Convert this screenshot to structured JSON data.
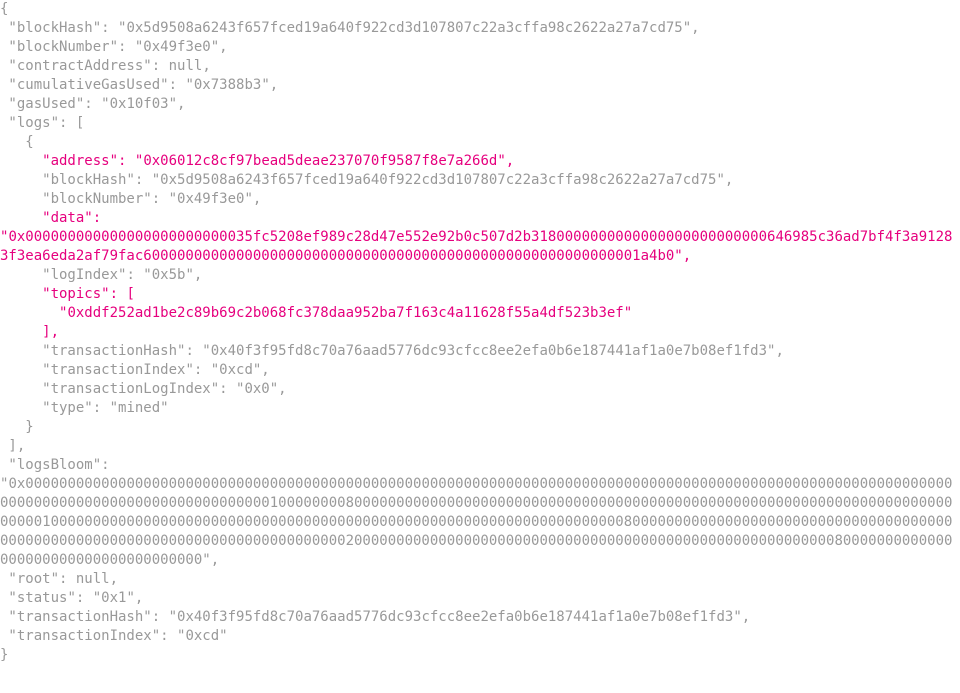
{
  "receipt": {
    "blockHash": "0x5d9508a6243f657fced19a640f922cd3d107807c22a3cffa98c2622a27a7cd75",
    "blockNumber": "0x49f3e0",
    "contractAddress": "null",
    "cumulativeGasUsed": "0x7388b3",
    "gasUsed": "0x10f03",
    "logs_open": "[",
    "log0": {
      "address": "0x06012c8cf97bead5deae237070f9587f8e7a266d",
      "blockHash": "0x5d9508a6243f657fced19a640f922cd3d107807c22a3cffa98c2622a27a7cd75",
      "blockNumber": "0x49f3e0",
      "data": "0x000000000000000000000000035fc5208ef989c28d47e552e92b0c507d2b3180000000000000000000000000646985c36ad7bf4f3a91283f3ea6eda2af79fac60000000000000000000000000000000000000000000000000000000001a4b0",
      "logIndex": "0x5b",
      "topics_open": "[",
      "topic0": "0xddf252ad1be2c89b69c2b068fc378daa952ba7f163c4a11628f55a4df523b3ef",
      "topics_close": "],",
      "transactionHash": "0x40f3f95fd8c70a76aad5776dc93cfcc8ee2efa0b6e187441af1a0e7b08ef1fd3",
      "transactionIndex": "0xcd",
      "transactionLogIndex": "0x0",
      "type": "mined"
    },
    "logs_close": "],",
    "logsBloom": "0x00000000000000000000000000000000000000000000000000000000000000000000000000000000000000000000000000000000000000000000000000000000000000000000001000000008000000000000000000000000000000000000000000000000000000000000000000000000000010000000000000000000000000000000000000000000000000000000000000000000080000000000000000000000000000000000000000000000000000000000000000000000000000000200000000000000000000000000000000000000000000000000000000080000000000000000000000000000000000000",
    "root": "null",
    "status": "0x1",
    "transactionHash": "0x40f3f95fd8c70a76aad5776dc93cfcc8ee2efa0b6e187441af1a0e7b08ef1fd3",
    "transactionIndex": "0xcd"
  },
  "labels": {
    "blockHash": "blockHash",
    "blockNumber": "blockNumber",
    "contractAddress": "contractAddress",
    "cumulativeGasUsed": "cumulativeGasUsed",
    "gasUsed": "gasUsed",
    "logs": "logs",
    "address": "address",
    "data": "data",
    "logIndex": "logIndex",
    "topics": "topics",
    "transactionHash": "transactionHash",
    "transactionIndex": "transactionIndex",
    "transactionLogIndex": "transactionLogIndex",
    "type": "type",
    "logsBloom": "logsBloom",
    "root": "root",
    "status": "status"
  }
}
